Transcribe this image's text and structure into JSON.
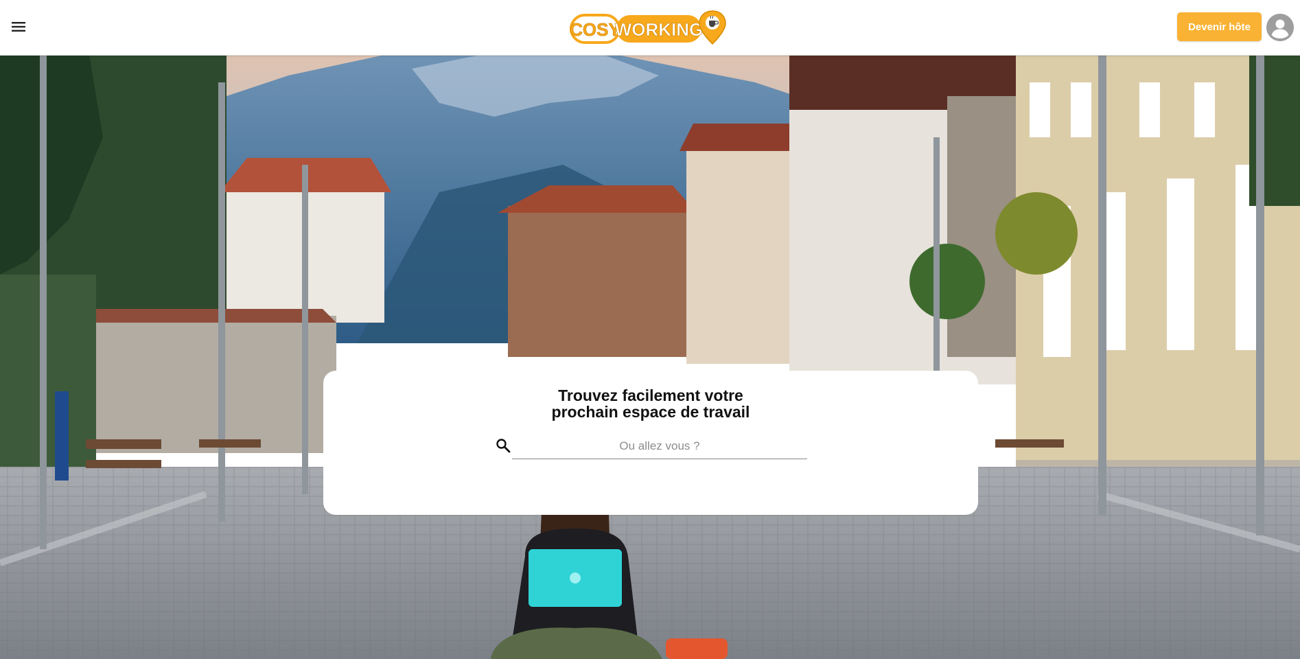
{
  "header": {
    "logo": {
      "text_left": "COSY",
      "text_right": "WORKING",
      "icon": "map-pin-cup-icon"
    },
    "menu_icon": "menu-icon",
    "host_button_label": "Devenir hôte",
    "avatar_icon": "user-avatar-icon"
  },
  "hero": {
    "image": "hero-photo-woman-laptop-cobblestone-street",
    "headline_line1": "Trouvez facilement votre",
    "headline_line2": "prochain espace de travail",
    "search": {
      "icon": "search-icon",
      "placeholder": "Ou allez vous ?",
      "value": ""
    }
  },
  "colors": {
    "accent": "#f9b233",
    "header_bg": "#ffffff",
    "card_bg": "#ffffff"
  }
}
